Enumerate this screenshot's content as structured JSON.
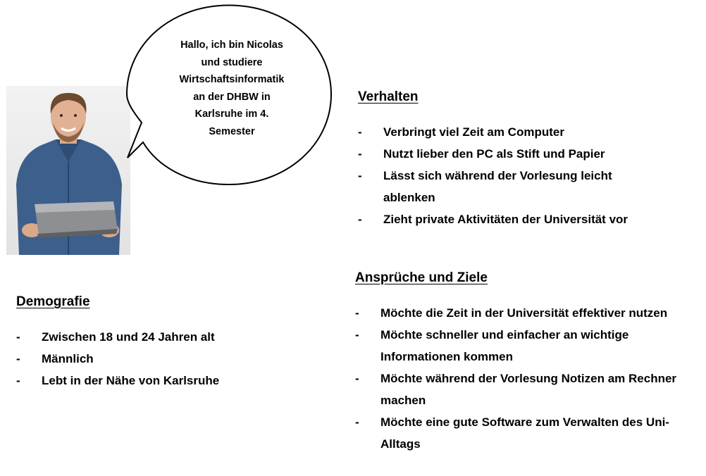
{
  "persona": {
    "photo_icon": "person-with-laptop-photo",
    "speech_bubble": "Hallo, ich bin Nicolas\nund studiere\nWirtschaftsinformatik\nan der DHBW in\nKarlsruhe im 4.\nSemester"
  },
  "verhalten": {
    "heading": "Verhalten",
    "items": [
      "Verbringt viel Zeit am Computer",
      "Nutzt lieber den PC als Stift und Papier",
      "Lässt sich während der Vorlesung leicht ablenken",
      "Zieht private Aktivitäten der Universität vor"
    ]
  },
  "ansprueche": {
    "heading": "Ansprüche und Ziele",
    "items": [
      "Möchte die Zeit in der Universität effektiver nutzen",
      "Möchte schneller und einfacher an wichtige Informationen kommen",
      "Möchte während der Vorlesung Notizen am Rechner machen",
      "Möchte eine gute Software zum Verwalten des Uni-Alltags"
    ]
  },
  "demografie": {
    "heading": "Demografie",
    "items": [
      "Zwischen 18 und 24 Jahren alt",
      "Männlich",
      "Lebt in der Nähe von Karlsruhe"
    ]
  },
  "bullet_char": "-"
}
